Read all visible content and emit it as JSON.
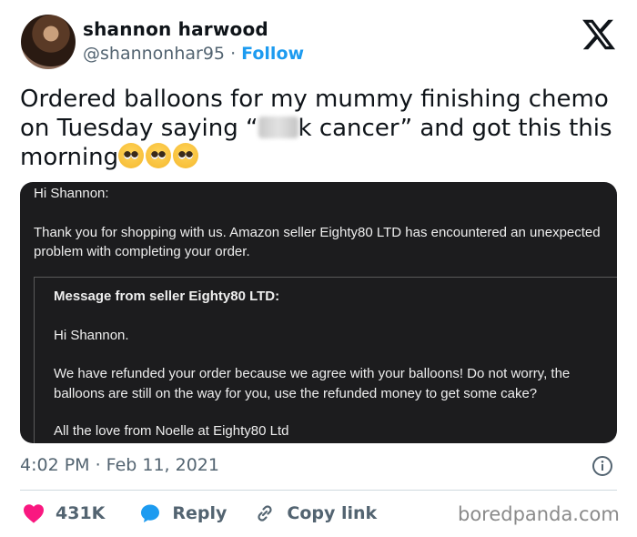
{
  "author": {
    "display_name": "shannon harwood",
    "handle": "@shannonhar95",
    "separator": "·",
    "follow_label": "Follow"
  },
  "tweet": {
    "text_part1": "Ordered balloons for my mummy finishing chemo on Tuesday saying “",
    "text_part2": "k cancer” and got this this morning",
    "emoji_name": "pleading-face-emoji",
    "emoji_count": 3
  },
  "email": {
    "greeting": "Hi Shannon:",
    "body": "Thank you for shopping with us. Amazon seller Eighty80 LTD has encountered an unexpected problem with completing your order.",
    "seller_title": "Message from seller Eighty80 LTD:",
    "seller_greeting": "Hi Shannon.",
    "seller_message": "We have refunded your order because we agree with your balloons! Do not worry, the balloons are still on the way for you, use the refunded money to get some cake?",
    "seller_signoff": "All the love from Noelle at Eighty80 Ltd"
  },
  "meta": {
    "timestamp": "4:02 PM · Feb 11, 2021"
  },
  "actions": {
    "like_count": "431K",
    "reply_label": "Reply",
    "copy_link_label": "Copy link"
  },
  "watermark": "boredpanda.com",
  "colors": {
    "accent": "#1d9bf0",
    "like": "#f91880",
    "text_secondary": "#536471",
    "email_bg": "#1c1c1e"
  }
}
